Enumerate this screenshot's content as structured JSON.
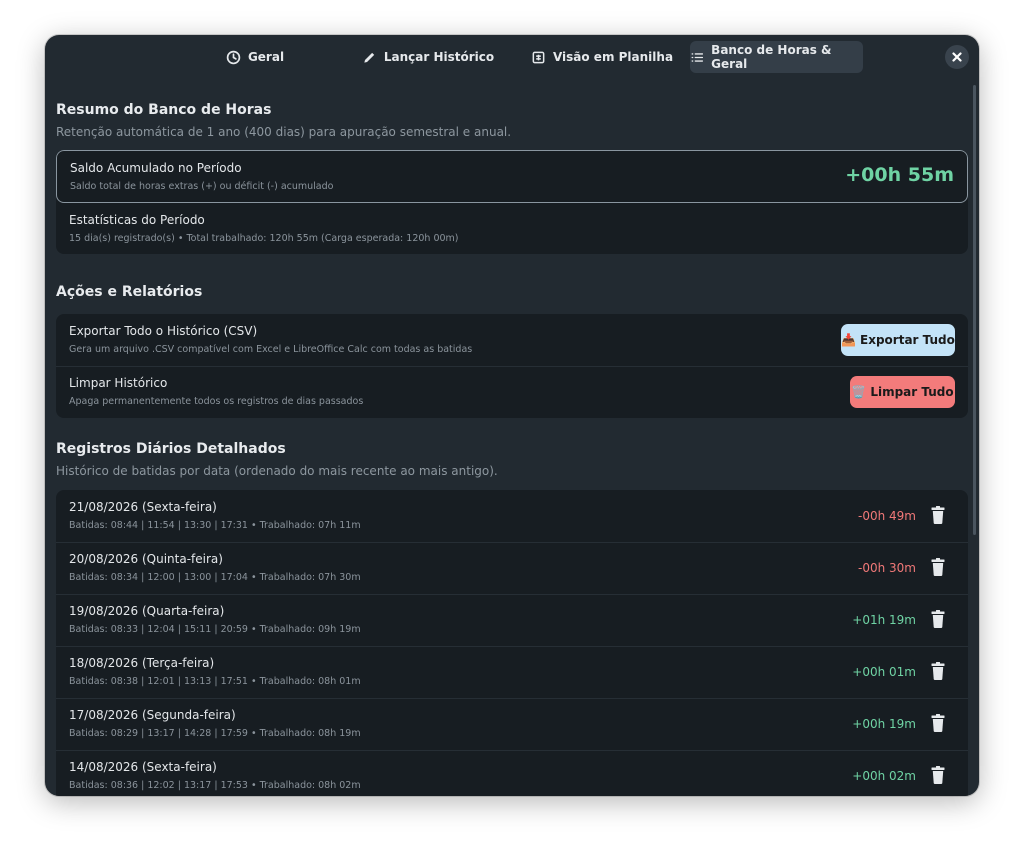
{
  "tabs": [
    {
      "label": "Geral",
      "icon": "clock-icon",
      "active": false
    },
    {
      "label": "Lançar Histórico",
      "icon": "pencil-icon",
      "active": false
    },
    {
      "label": "Visão em Planilha",
      "icon": "table-icon",
      "active": false
    },
    {
      "label": "Banco de Horas & Geral",
      "icon": "list-icon",
      "active": true
    }
  ],
  "summary": {
    "title": "Resumo do Banco de Horas",
    "subtitle": "Retenção automática de 1 ano (400 dias) para apuração semestral e anual.",
    "balance_label": "Saldo Acumulado no Período",
    "balance_desc": "Saldo total de horas extras (+) ou déficit (-) acumulado",
    "balance_value": "+00h 55m",
    "stats_label": "Estatísticas do Período",
    "stats_desc": "15 dia(s) registrado(s) • Total trabalhado: 120h 55m (Carga esperada: 120h 00m)"
  },
  "actions": {
    "title": "Ações e Relatórios",
    "export_label": "Exportar Todo o Histórico (CSV)",
    "export_desc": "Gera um arquivo .CSV compatível com Excel e LibreOffice Calc com todas as batidas",
    "export_button": "Exportar Tudo",
    "export_emoji": "📥",
    "clear_label": "Limpar Histórico",
    "clear_desc": "Apaga permanentemente todos os registros de dias passados",
    "clear_button": "Limpar Tudo",
    "clear_emoji": "🗑️"
  },
  "records": {
    "title": "Registros Diários Detalhados",
    "subtitle": "Histórico de batidas por data (ordenado do mais recente ao mais antigo).",
    "items": [
      {
        "date": "21/08/2026 (Sexta-feira)",
        "detail": "Batidas: 08:44 | 11:54 | 13:30 | 17:31  •  Trabalhado: 07h 11m",
        "balance": "-00h 49m",
        "negative": true
      },
      {
        "date": "20/08/2026 (Quinta-feira)",
        "detail": "Batidas: 08:34 | 12:00 | 13:00 | 17:04  •  Trabalhado: 07h 30m",
        "balance": "-00h 30m",
        "negative": true
      },
      {
        "date": "19/08/2026 (Quarta-feira)",
        "detail": "Batidas: 08:33 | 12:04 | 15:11 | 20:59  •  Trabalhado: 09h 19m",
        "balance": "+01h 19m",
        "negative": false
      },
      {
        "date": "18/08/2026 (Terça-feira)",
        "detail": "Batidas: 08:38 | 12:01 | 13:13 | 17:51  •  Trabalhado: 08h 01m",
        "balance": "+00h 01m",
        "negative": false
      },
      {
        "date": "17/08/2026 (Segunda-feira)",
        "detail": "Batidas: 08:29 | 13:17 | 14:28 | 17:59  •  Trabalhado: 08h 19m",
        "balance": "+00h 19m",
        "negative": false
      },
      {
        "date": "14/08/2026 (Sexta-feira)",
        "detail": "Batidas: 08:36 | 12:02 | 13:17 | 17:53  •  Trabalhado: 08h 02m",
        "balance": "+00h 02m",
        "negative": false
      }
    ]
  },
  "colors": {
    "window_bg": "#222a31",
    "card_bg": "#171d22",
    "positive": "#6fd3a4",
    "negative": "#f07878",
    "export_button": "#c3e3f8",
    "clear_button": "#f37b7b"
  }
}
